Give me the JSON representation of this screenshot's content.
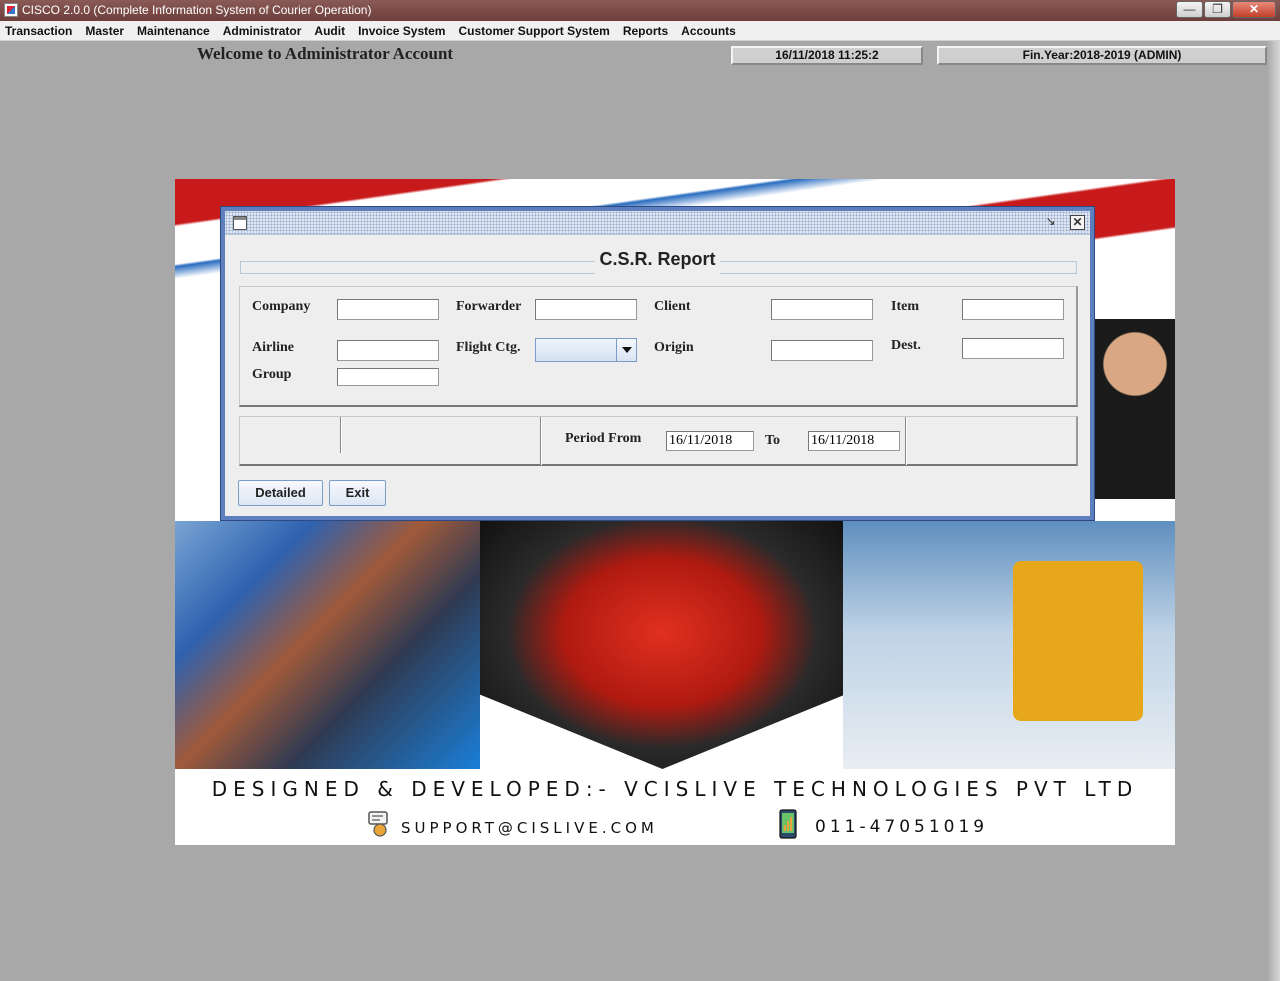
{
  "window": {
    "title": "CISCO 2.0.0 (Complete Information System of Courier Operation)",
    "controls": [
      "minimize-icon",
      "maximize-icon",
      "close-icon"
    ]
  },
  "menu": [
    "Transaction",
    "Master",
    "Maintenance",
    "Administrator",
    "Audit",
    "Invoice System",
    "Customer Support System",
    "Reports",
    "Accounts"
  ],
  "header": {
    "welcome": "Welcome to Administrator Account",
    "datetime": "16/11/2018     11:25:2",
    "fin_year": "Fin.Year:2018-2019  (ADMIN)"
  },
  "banner": {
    "developer": "DESIGNED & DEVELOPED:- VCISLIVE TECHNOLOGIES PVT LTD",
    "email": "SUPPORT@CISLIVE.COM",
    "phone": "011-47051019"
  },
  "dialog": {
    "title": "C.S.R. Report",
    "labels": {
      "company": "Company",
      "forwarder": "Forwarder",
      "client": "Client",
      "item": "Item",
      "airline": "Airline",
      "flight_ctg": "Flight Ctg.",
      "origin": "Origin",
      "dest": "Dest.",
      "group": "Group",
      "period_from": "Period From",
      "to": "To"
    },
    "values": {
      "company": "",
      "forwarder": "",
      "client": "",
      "item": "",
      "airline": "",
      "flight_ctg": "",
      "origin": "",
      "dest": "",
      "group": "",
      "from_date": "16/11/2018",
      "to_date": "16/11/2018"
    },
    "buttons": {
      "detailed": "Detailed",
      "exit": "Exit"
    }
  },
  "colors": {
    "title_bar": "#6e3e3b",
    "dialog_border": "#5d7fbd",
    "desktop": "#a8a8a8"
  }
}
